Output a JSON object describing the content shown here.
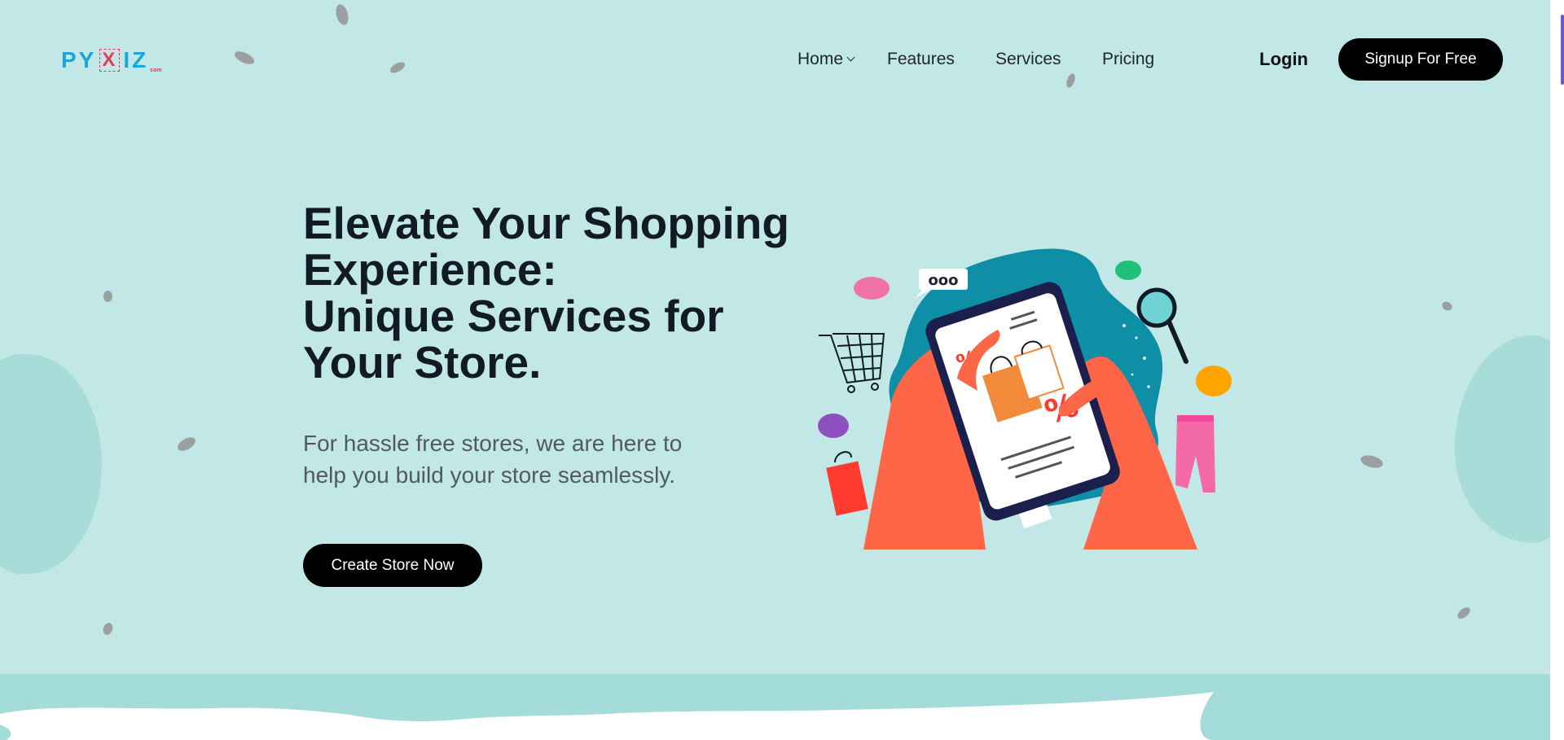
{
  "logo": {
    "left": "PY",
    "mark": "X",
    "right": "IZ",
    "suffix": "com"
  },
  "nav": {
    "items": [
      {
        "label": "Home",
        "has_dropdown": true
      },
      {
        "label": "Features"
      },
      {
        "label": "Services"
      },
      {
        "label": "Pricing"
      }
    ],
    "login_label": "Login",
    "signup_label": "Signup For Free"
  },
  "hero": {
    "title_lines": [
      "Elevate Your Shopping",
      "Experience:",
      "Unique Services for",
      "Your Store."
    ],
    "subtitle_lines": [
      "For hassle free stores, we are here to",
      "help you build your store seamlessly."
    ],
    "cta_label": "Create Store Now"
  },
  "illustration": {
    "speech_bubble": "ooo",
    "percent_big": "%",
    "percent_small": "%"
  },
  "colors": {
    "background": "#c1e7e6",
    "blob": "#a7dcd9",
    "button": "#000000",
    "logo_blue": "#1aa6d9",
    "logo_red": "#e43b4e",
    "hand": "#ff6647",
    "splash": "#0e8fa6"
  }
}
